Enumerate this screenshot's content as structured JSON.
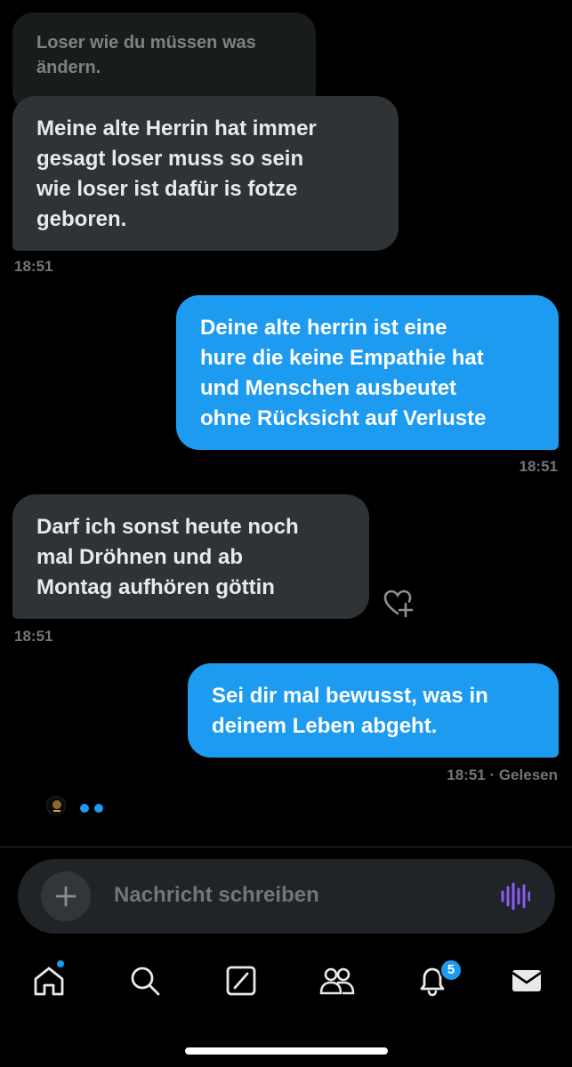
{
  "messages": [
    {
      "text": "Loser wie du müssen was\nändern."
    },
    {
      "text": "Meine alte Herrin hat immer\ngesagt loser muss so sein\nwie loser ist dafür is fotze\ngeboren.",
      "time": "18:51"
    },
    {
      "text": "Deine alte herrin ist eine\nhure die keine Empathie hat\nund Menschen ausbeutet\nohne Rücksicht auf Verluste",
      "time": "18:51"
    },
    {
      "text": "Darf ich sonst heute noch\nmal Dröhnen und ab\nMontag aufhören göttin",
      "time": "18:51"
    },
    {
      "text": "Sei dir mal bewusst, was in\ndeinem Leben abgeht.",
      "time": "18:51 · Gelesen"
    }
  ],
  "composer": {
    "placeholder": "Nachricht schreiben",
    "plus_icon": "plus-icon",
    "voice_icon": "voice-waveform-icon"
  },
  "nav": {
    "items": [
      "home-icon",
      "search-icon",
      "grok-icon",
      "communities-icon",
      "notifications-icon",
      "messages-icon"
    ],
    "notification_count": "5"
  },
  "colors": {
    "background": "#000000",
    "incoming_bubble": "#2f3336",
    "outgoing_bubble": "#1d9bf0",
    "accent": "#1d9bf0",
    "voice_icon": "#8b5cf6"
  }
}
